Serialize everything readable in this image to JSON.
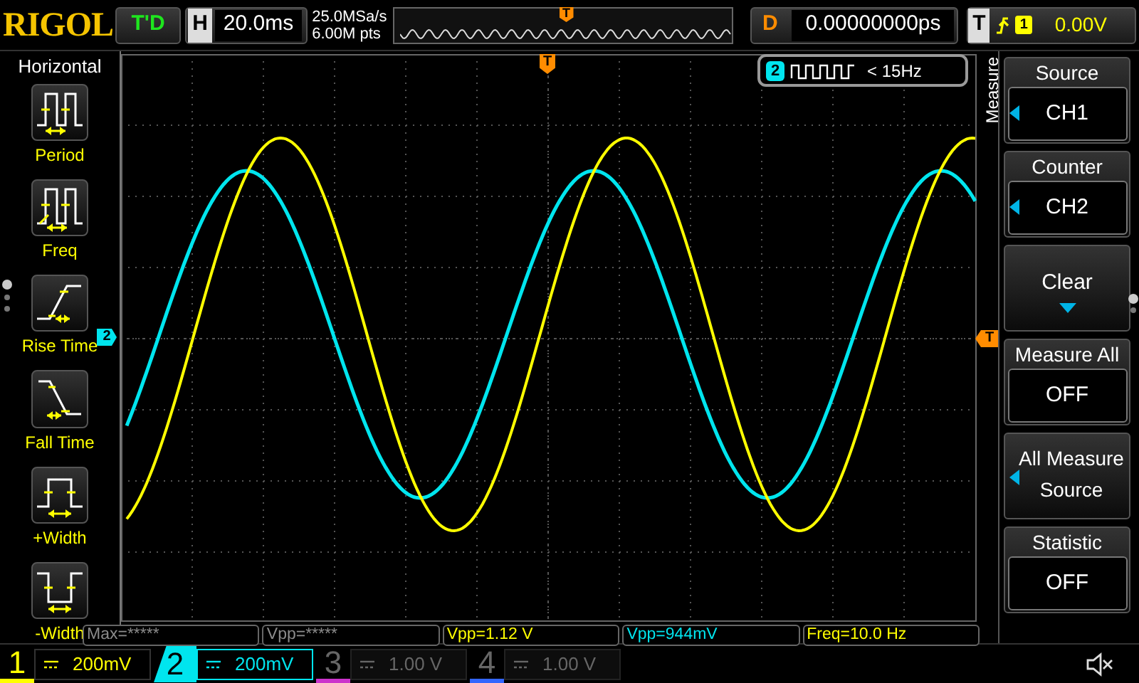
{
  "brand": "RIGOL",
  "run_state": "T'D",
  "horizontal": {
    "label": "H",
    "timebase": "20.0ms",
    "sample_rate": "25.0MSa/s",
    "memory_depth": "6.00M pts",
    "trigger_marker": "T"
  },
  "delay": {
    "label": "D",
    "value": "0.00000000ps"
  },
  "trigger": {
    "label": "T",
    "channel": "1",
    "level": "0.00V"
  },
  "left_menu": {
    "title": "Horizontal",
    "items": [
      {
        "kind": "period",
        "label": "Period"
      },
      {
        "kind": "freq",
        "label": "Freq"
      },
      {
        "kind": "rise",
        "label": "Rise Time"
      },
      {
        "kind": "fall",
        "label": "Fall Time"
      },
      {
        "kind": "pwidth",
        "label": "+Width"
      },
      {
        "kind": "nwidth",
        "label": "-Width"
      }
    ]
  },
  "screen": {
    "ground_marker": "2",
    "trigger_position_marker": "T",
    "trigger_level_marker": "T",
    "counter": {
      "channel": "2",
      "reading": "< 15Hz"
    }
  },
  "right_menu": {
    "title": "Measure",
    "items": [
      {
        "kind": "choice",
        "label": "Source",
        "value": "CH1"
      },
      {
        "kind": "choice",
        "label": "Counter",
        "value": "CH2"
      },
      {
        "kind": "action",
        "label": "Clear"
      },
      {
        "kind": "toggle",
        "label": "Measure All",
        "value": "OFF"
      },
      {
        "kind": "submenu",
        "label": "All Measure Source"
      },
      {
        "kind": "toggle",
        "label": "Statistic",
        "value": "OFF"
      }
    ]
  },
  "measurements": [
    {
      "text": "Max=*****",
      "color": "#8c8c8c"
    },
    {
      "text": "Vpp=*****",
      "color": "#8c8c8c"
    },
    {
      "text": "Vpp=1.12 V",
      "color": "#ffff00"
    },
    {
      "text": "Vpp=944mV",
      "color": "#00e5ee"
    },
    {
      "text": "Freq=10.0 Hz",
      "color": "#ffff00"
    }
  ],
  "channels": [
    {
      "number": "1",
      "scale": "200mV",
      "color": "#ffff00",
      "on": true,
      "selected": false
    },
    {
      "number": "2",
      "scale": "200mV",
      "color": "#00e5ee",
      "on": true,
      "selected": true
    },
    {
      "number": "3",
      "scale": "1.00 V",
      "color": "#cc33cc",
      "on": false,
      "selected": false
    },
    {
      "number": "4",
      "scale": "1.00 V",
      "color": "#3366ff",
      "on": false,
      "selected": false
    }
  ]
}
